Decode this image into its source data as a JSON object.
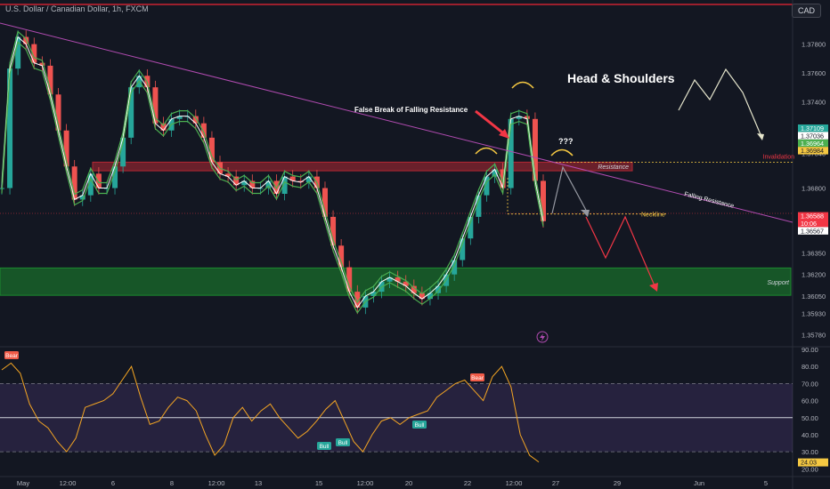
{
  "header": {
    "title": "U.S. Dollar / Canadian Dollar, 1h, FXCM",
    "currency": "CAD"
  },
  "chart_data": [
    {
      "type": "candlestick",
      "title": "U.S. Dollar / Canadian Dollar, 1h, FXCM",
      "x_tick_labels": [
        "May",
        "12:00",
        "6",
        "8",
        "12:00",
        "13",
        "15",
        "12:00",
        "20",
        "22",
        "12:00",
        "27",
        "29",
        "Jun",
        "5"
      ],
      "y_ticks": [
        1.3578,
        1.3593,
        1.3605,
        1.362,
        1.3635,
        1.365,
        1.368,
        1.3704,
        1.3713,
        1.374,
        1.376,
        1.378
      ],
      "ylim": [
        1.3571,
        1.3802
      ],
      "price_labels": [
        {
          "text": "1.37109",
          "value": 1.37109,
          "color": "#26a69a"
        },
        {
          "text": "1.37036",
          "value": 1.37036,
          "color": "#ffffff"
        },
        {
          "text": "1.36964",
          "value": 1.36964,
          "color": "#4caf50"
        },
        {
          "text": "1.36984",
          "value": 1.36984,
          "color": "#f5c842"
        },
        {
          "text": "1.36588",
          "value": 1.36588,
          "color": "#f23645"
        },
        {
          "text": "10:06",
          "value": 1.36545,
          "color": "#f23645"
        },
        {
          "text": "1.36567",
          "value": 1.36567,
          "color": "#ffffff"
        }
      ],
      "zones": [
        {
          "label": "Resistance",
          "from": 1.3692,
          "to": 1.3698,
          "color": "#b22833"
        },
        {
          "label": "Support",
          "from": 1.36055,
          "to": 1.36245,
          "color": "#1b8a2e"
        }
      ],
      "levels": [
        {
          "label": "Invalidation",
          "value": 1.3698,
          "color": "#f5c842"
        },
        {
          "label": "Neckline",
          "value": 1.3662,
          "color": "#f5c842"
        }
      ],
      "trendline_label": "Falling Resistance",
      "annotations": [
        "Head & Shoulders",
        "False Break of Falling Resistance",
        "???"
      ],
      "series": [
        {
          "name": "close",
          "color": "#26a69a",
          "values": [
            1.368,
            1.3763,
            1.3785,
            1.378,
            1.3767,
            1.3765,
            1.3745,
            1.372,
            1.3695,
            1.3672,
            1.3675,
            1.369,
            1.368,
            1.368,
            1.3695,
            1.3715,
            1.375,
            1.3758,
            1.375,
            1.3725,
            1.372,
            1.3728,
            1.373,
            1.373,
            1.3725,
            1.3715,
            1.3698,
            1.369,
            1.3688,
            1.3682,
            1.3685,
            1.368,
            1.368,
            1.3685,
            1.3676,
            1.3688,
            1.3685,
            1.3684,
            1.3688,
            1.368,
            1.366,
            1.364,
            1.3625,
            1.3608,
            1.3597,
            1.3605,
            1.3608,
            1.3615,
            1.3618,
            1.3615,
            1.3612,
            1.3607,
            1.3603,
            1.3607,
            1.3612,
            1.362,
            1.363,
            1.3645,
            1.366,
            1.3675,
            1.3688,
            1.3693,
            1.368,
            1.3728,
            1.373,
            1.3728,
            1.3685,
            1.3657
          ]
        }
      ]
    },
    {
      "type": "line",
      "title": "",
      "ylim": [
        16,
        90
      ],
      "y_ticks": [
        20,
        30,
        40,
        50,
        60,
        70,
        80,
        90
      ],
      "bands": [
        30,
        50,
        70
      ],
      "current_label": "24.03",
      "signals": [
        {
          "text": "Bear",
          "color": "#f05b48"
        },
        {
          "text": "Bull",
          "color": "#26a69a"
        },
        {
          "text": "Bull",
          "color": "#26a69a"
        },
        {
          "text": "Bull",
          "color": "#26a69a"
        },
        {
          "text": "Bear",
          "color": "#f05b48"
        }
      ],
      "series": [
        {
          "name": "rsi",
          "color": "#f5a623",
          "values": [
            78,
            82,
            76,
            58,
            48,
            44,
            36,
            30,
            38,
            56,
            58,
            60,
            64,
            72,
            80,
            62,
            46,
            48,
            56,
            62,
            60,
            54,
            40,
            28,
            34,
            50,
            56,
            48,
            54,
            58,
            50,
            44,
            38,
            42,
            48,
            55,
            60,
            48,
            36,
            30,
            40,
            48,
            50,
            46,
            50,
            52,
            54,
            62,
            66,
            70,
            72,
            66,
            60,
            74,
            80,
            68,
            40,
            28,
            24
          ]
        }
      ]
    }
  ]
}
